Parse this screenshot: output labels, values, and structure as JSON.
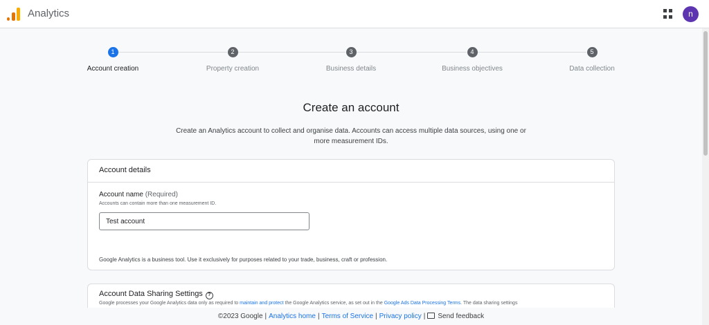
{
  "header": {
    "app_title": "Analytics",
    "avatar_initial": "n",
    "brand_colors": [
      "#e37400",
      "#f9ab00"
    ]
  },
  "stepper": {
    "steps": [
      {
        "number": "1",
        "label": "Account creation",
        "active": true
      },
      {
        "number": "2",
        "label": "Property creation",
        "active": false
      },
      {
        "number": "3",
        "label": "Business details",
        "active": false
      },
      {
        "number": "4",
        "label": "Business objectives",
        "active": false
      },
      {
        "number": "5",
        "label": "Data collection",
        "active": false
      }
    ],
    "active_color": "#1a73e8"
  },
  "main": {
    "title": "Create an account",
    "description": "Create an Analytics account to collect and organise data. Accounts can access multiple data sources, using one or more measurement IDs."
  },
  "account_details": {
    "title": "Account details",
    "field_label": "Account name",
    "field_required": "(Required)",
    "field_hint": "Accounts can contain more than one measurement ID.",
    "field_value": "Test account",
    "note": "Google Analytics is a business tool. Use it exclusively for purposes related to your trade, business, craft or profession."
  },
  "data_sharing": {
    "title": "Account Data Sharing Settings",
    "text_before": "Google processes your Google Analytics data only as required to ",
    "link1": "maintain and protect",
    "text_middle": " the Google Analytics service, as set out in the ",
    "link2": "Google Ads Data Processing Terms",
    "text_after": ". The data sharing settings"
  },
  "footer": {
    "copyright": "©2023 Google",
    "links": [
      "Analytics home",
      "Terms of Service",
      "Privacy policy"
    ],
    "feedback": "Send feedback"
  }
}
